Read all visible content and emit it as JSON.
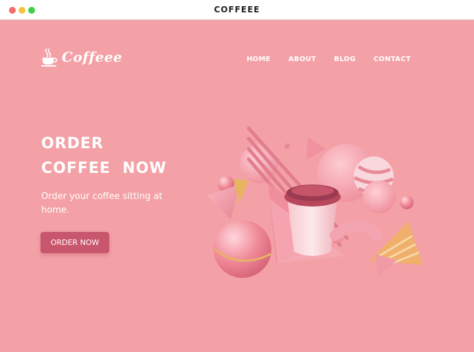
{
  "window": {
    "title": "COFFEEE"
  },
  "brand": {
    "name": "Coffeee",
    "icon": "coffee-cup-icon"
  },
  "nav": {
    "items": [
      {
        "label": "HOME"
      },
      {
        "label": "ABOUT"
      },
      {
        "label": "BLOG"
      },
      {
        "label": "CONTACT"
      }
    ]
  },
  "hero": {
    "title_line1": "ORDER",
    "title_line2": "COFFEE  NOW",
    "subtitle": "Order your coffee sitting at home.",
    "cta_label": "ORDER NOW"
  },
  "colors": {
    "background": "#f3a1a6",
    "button": "#c8566c",
    "text": "#ffffff"
  }
}
